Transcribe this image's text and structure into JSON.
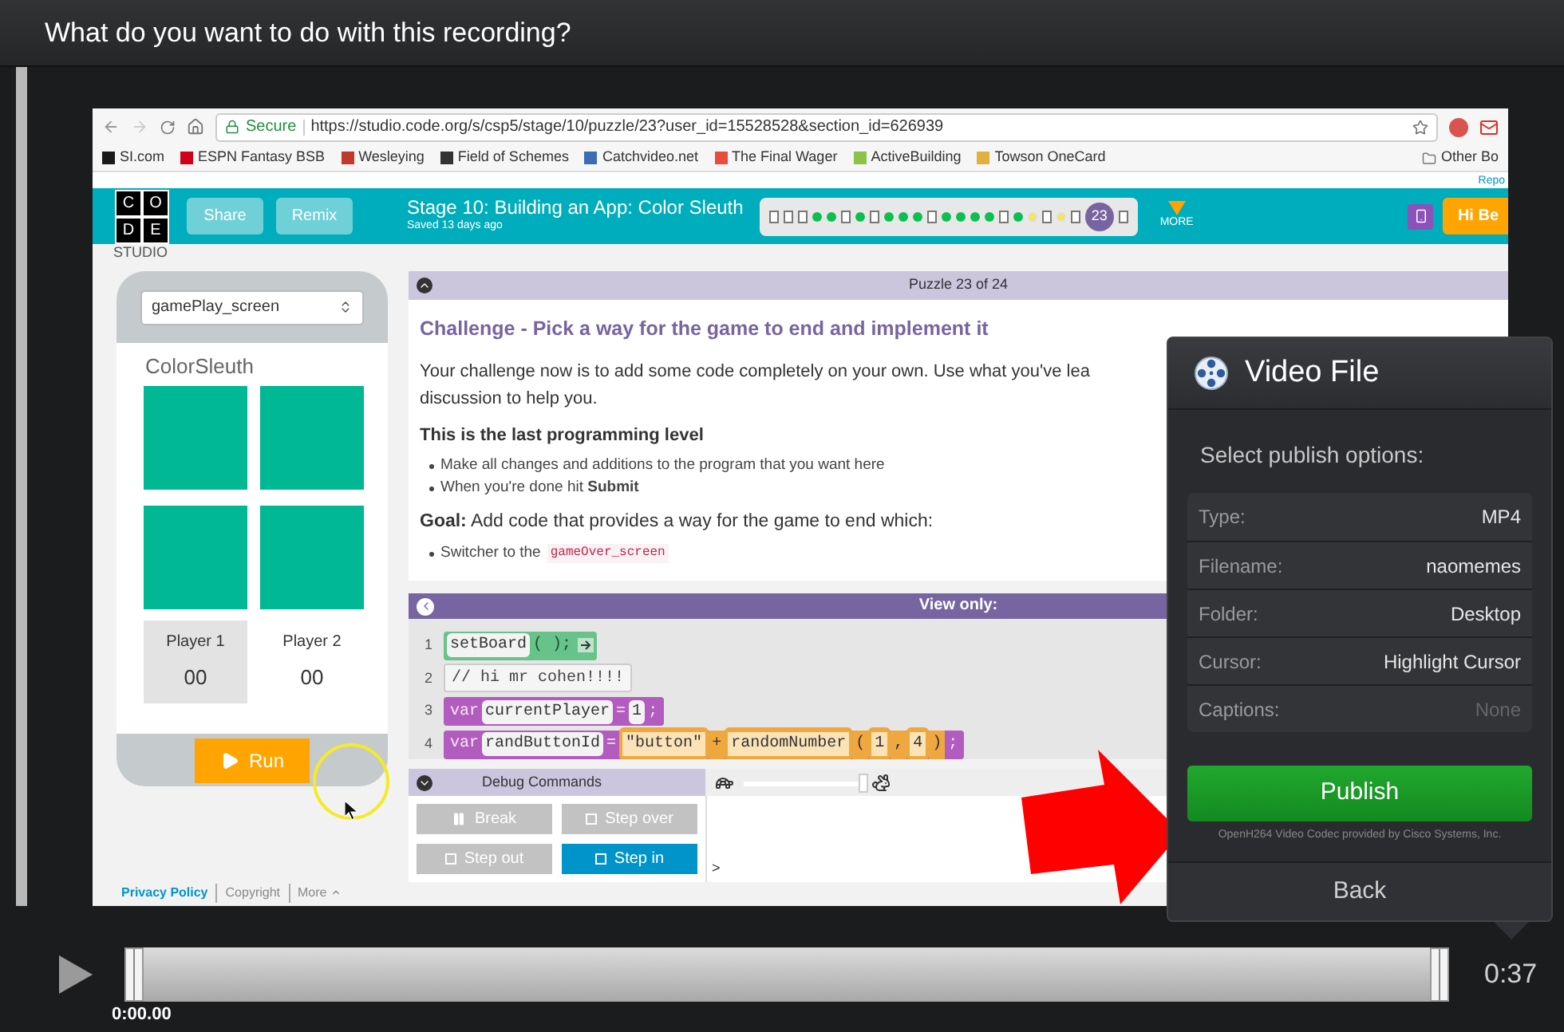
{
  "window": {
    "title": "What do you want to do with this recording?"
  },
  "browser": {
    "secure_label": "Secure",
    "url": "https://studio.code.org/s/csp5/stage/10/puzzle/23?user_id=15528528&section_id=626939",
    "bookmarks": [
      {
        "label": "SI.com",
        "color": "#1a1a1a"
      },
      {
        "label": "ESPN Fantasy BSB",
        "color": "#d0021b"
      },
      {
        "label": "Wesleying",
        "color": "#c0392b"
      },
      {
        "label": "Field of Schemes",
        "color": "#333333"
      },
      {
        "label": "Catchvideo.net",
        "color": "#3b6db5"
      },
      {
        "label": "The Final Wager",
        "color": "#e74c3c"
      },
      {
        "label": "ActiveBuilding",
        "color": "#8bc34a"
      },
      {
        "label": "Towson OneCard",
        "color": "#e0b040"
      }
    ],
    "other_bookmarks": "Other Bo"
  },
  "site": {
    "report_link": "Repo",
    "logo_letters": [
      "C",
      "O",
      "D",
      "E"
    ],
    "logo_subtitle": "STUDIO",
    "buttons": [
      "Share",
      "Remix"
    ],
    "stage_title": "Stage 10: Building an App: Color Sleuth",
    "saved": "Saved 13 days ago",
    "progress": [
      {
        "kind": "doc"
      },
      {
        "kind": "doc"
      },
      {
        "kind": "doc"
      },
      {
        "kind": "done"
      },
      {
        "kind": "done"
      },
      {
        "kind": "doc"
      },
      {
        "kind": "done"
      },
      {
        "kind": "doc"
      },
      {
        "kind": "done"
      },
      {
        "kind": "done"
      },
      {
        "kind": "done"
      },
      {
        "kind": "doc"
      },
      {
        "kind": "done"
      },
      {
        "kind": "done"
      },
      {
        "kind": "done"
      },
      {
        "kind": "done"
      },
      {
        "kind": "doc"
      },
      {
        "kind": "done"
      },
      {
        "kind": "attempted"
      },
      {
        "kind": "doc"
      },
      {
        "kind": "attempted"
      },
      {
        "kind": "doc"
      },
      {
        "kind": "current",
        "label": "23"
      },
      {
        "kind": "doc"
      }
    ],
    "more": "MORE",
    "greeting": "Hi Be"
  },
  "app_preview": {
    "screen_select": "gamePlay_screen",
    "app_title": "ColorSleuth",
    "tiles": [
      {
        "kind": "square"
      },
      {
        "kind": "square"
      },
      {
        "kind": "square"
      },
      {
        "kind": "square"
      }
    ],
    "players": [
      {
        "label": "Player 1",
        "score": "00",
        "selected": true
      },
      {
        "label": "Player 2",
        "score": "00",
        "selected": false
      }
    ],
    "run_button": "Run"
  },
  "instructions": {
    "header": "Puzzle 23 of 24",
    "heading": "Challenge - Pick a way for the game to end and implement it",
    "intro_lines": [
      "Your challenge now is to add some code completely on your own. Use what you've lea",
      "discussion to help you."
    ],
    "subheading": "This is the last programming level",
    "bullets": [
      "Make all changes and additions to the program that you want here",
      "When you're done hit **Submit**"
    ],
    "goal": "**Goal:** Add code that provides a way for the game to end which:",
    "sub_bullet": {
      "text": "Switcher to the",
      "code": "gameOver_screen"
    }
  },
  "code": {
    "header": "View only:",
    "lines": [
      {
        "number": "1",
        "kind": "call",
        "tokens": [
          {
            "kind": "slot",
            "text": "setBoard"
          },
          {
            "kind": "text",
            "text": "( );"
          }
        ]
      },
      {
        "number": "2",
        "kind": "comment",
        "tokens": [
          {
            "kind": "text",
            "text": "// hi mr cohen!!!!"
          }
        ]
      },
      {
        "number": "3",
        "kind": "var",
        "tokens": [
          {
            "kind": "text",
            "text": "var"
          },
          {
            "kind": "slot",
            "text": "currentPlayer"
          },
          {
            "kind": "text",
            "text": "="
          },
          {
            "kind": "slot",
            "text": "1"
          },
          {
            "kind": "text",
            "text": ";"
          }
        ]
      },
      {
        "number": "4",
        "kind": "var",
        "tokens": [
          {
            "kind": "text",
            "text": "var"
          },
          {
            "kind": "slot",
            "text": "randButtonId"
          },
          {
            "kind": "text",
            "text": "="
          },
          {
            "kind": "expr_slot",
            "text": "\"button\""
          },
          {
            "kind": "expr_text",
            "text": "+"
          },
          {
            "kind": "expr_slot",
            "text": "randomNumber"
          },
          {
            "kind": "expr_text",
            "text": "("
          },
          {
            "kind": "expr_slot",
            "text": "1"
          },
          {
            "kind": "expr_text",
            "text": ","
          },
          {
            "kind": "expr_slot",
            "text": "4"
          },
          {
            "kind": "expr_text",
            "text": ")"
          },
          {
            "kind": "text",
            "text": ";"
          }
        ]
      }
    ]
  },
  "debug": {
    "header": "Debug Commands",
    "buttons": [
      {
        "label": "Break",
        "disabled": true
      },
      {
        "label": "Step over",
        "disabled": true
      },
      {
        "label": "Step out",
        "disabled": true
      },
      {
        "label": "Step in",
        "disabled": false
      }
    ],
    "speed": {
      "level": 1
    },
    "console_prompt": ">"
  },
  "footer": {
    "links": [
      "Privacy Policy",
      "Copyright",
      "More"
    ]
  },
  "publish_panel": {
    "title": "Video File",
    "prompt": "Select publish options:",
    "options": [
      {
        "label": "Type:",
        "value": "MP4",
        "disabled": false
      },
      {
        "label": "Filename:",
        "value": "naomemes",
        "disabled": false
      },
      {
        "label": "Folder:",
        "value": "Desktop",
        "disabled": false
      },
      {
        "label": "Cursor:",
        "value": "Highlight Cursor",
        "disabled": false
      },
      {
        "label": "Captions:",
        "value": "None",
        "disabled": true
      }
    ],
    "publish": "Publish",
    "codec_note": "OpenH264 Video Codec provided by Cisco Systems, Inc.",
    "back": "Back"
  },
  "player": {
    "playhead": {
      "level": 0
    },
    "current_time": "0:00.00",
    "duration": "0:37"
  }
}
